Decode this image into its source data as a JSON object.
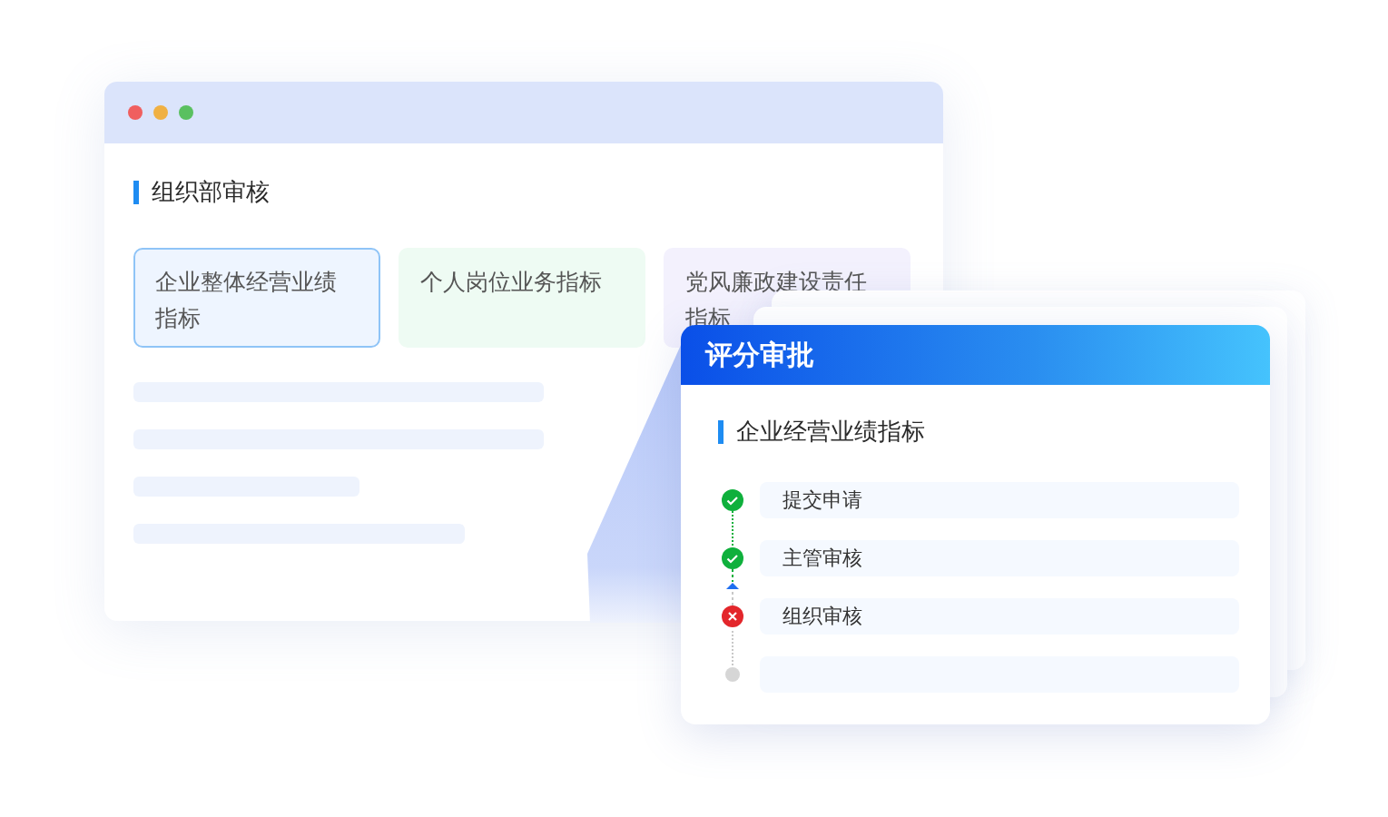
{
  "window": {
    "section_title": "组织部审核",
    "tabs": [
      {
        "label": "企业整体经营业绩指标",
        "selected": true,
        "color": "#eef5ff"
      },
      {
        "label": "个人岗位业务指标",
        "selected": false,
        "color": "#eefbf3"
      },
      {
        "label": "党风廉政建设责任指标",
        "selected": false,
        "color": "#f3f1fd"
      }
    ]
  },
  "approval_card": {
    "title": "评分审批",
    "section_title": "企业经营业绩指标",
    "steps": [
      {
        "kind": "done",
        "label": "提交申请"
      },
      {
        "kind": "done",
        "label": "主管审核"
      },
      {
        "kind": "rejected",
        "label": "组织审核"
      },
      {
        "kind": "pending"
      }
    ]
  }
}
